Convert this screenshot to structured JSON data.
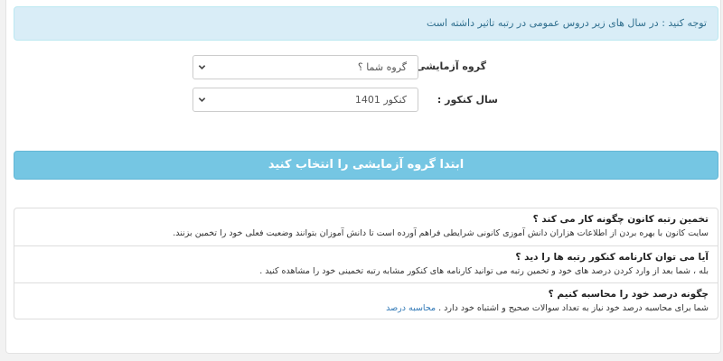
{
  "notice": {
    "text": "توجه کنید : در سال های زیر دروس عمومی در رتبه تاثیر داشته است"
  },
  "form": {
    "group": {
      "label": "گروه آزمایشی :",
      "selected": "گروه شما ؟"
    },
    "year": {
      "label": "سال کنکور :",
      "selected": "کنکور 1401"
    }
  },
  "submit": {
    "label": "ابتدا گروه آزمایشی را انتخاب کنید"
  },
  "faq": {
    "items": [
      {
        "question": "تخمین رتبه کانون چگونه کار می کند ؟",
        "answer": "سایت کانون با بهره بردن از اطلاعات هزاران دانش آموزی کانونی شرایطی فراهم آورده است تا دانش آموزان بتوانند وضعیت فعلی خود را تخمین بزنند."
      },
      {
        "question": "آیا می توان کارنامه کنکور رتبه ها را دید ؟",
        "answer": "بله ، شما بعد از وارد کردن درصد های خود و تخمین رتبه می توانید کارنامه های کنکور مشابه رتبه تخمینی خود را مشاهده کنید ."
      },
      {
        "question": "چگونه درصد خود را محاسبه کنیم ؟",
        "answer": "شما برای محاسبه درصد خود نیاز به تعداد سوالات صحیح و اشتباه خود دارد .",
        "link": "محاسبه درصد"
      }
    ]
  },
  "colors": {
    "notice_bg": "#d9edf7",
    "notice_text": "#31708f",
    "button_bg": "#6ec4e2",
    "link": "#337ab7"
  }
}
